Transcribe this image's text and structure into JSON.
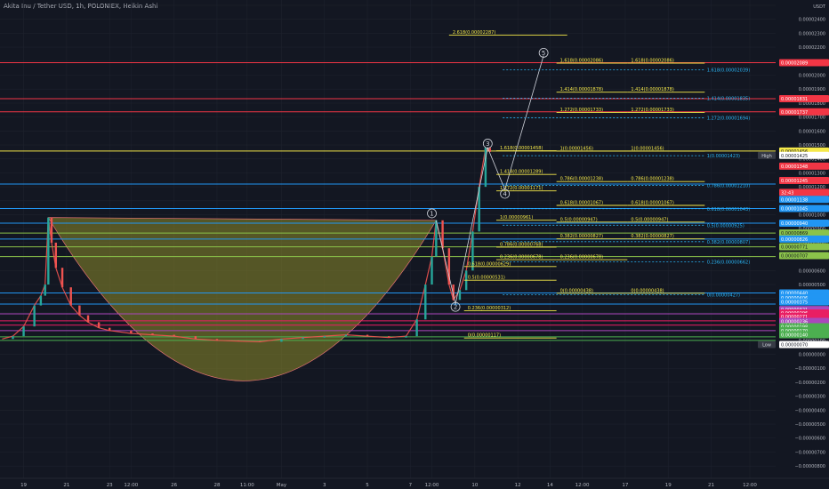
{
  "header": {
    "title": "Akita Inu / Tether USD, 1h, POLONIEX, Heikin Ashi"
  },
  "chart_data": {
    "type": "candlestick",
    "quote": "USDT",
    "ylim": [
      -8.5e-06,
      2.5e-05
    ],
    "y_ticks": [
      {
        "v": 2.5e-05,
        "label": "0.00002500"
      },
      {
        "v": 2.4e-05,
        "label": "0.00002400"
      },
      {
        "v": 2.3e-05,
        "label": "0.00002300"
      },
      {
        "v": 2.2e-05,
        "label": "0.00002200"
      },
      {
        "v": 2.1e-05,
        "label": "0.00002100"
      },
      {
        "v": 2e-05,
        "label": "0.00002000"
      },
      {
        "v": 1.9e-05,
        "label": "0.00001900"
      },
      {
        "v": 1.8e-05,
        "label": "0.00001800"
      },
      {
        "v": 1.7e-05,
        "label": "0.00001700"
      },
      {
        "v": 1.6e-05,
        "label": "0.00001600"
      },
      {
        "v": 1.5e-05,
        "label": "0.00001500"
      },
      {
        "v": 1.4e-05,
        "label": "0.00001400"
      },
      {
        "v": 1.3e-05,
        "label": "0.00001300"
      },
      {
        "v": 1.2e-05,
        "label": "0.00001200"
      },
      {
        "v": 1.1e-05,
        "label": "0.00001100"
      },
      {
        "v": 1e-05,
        "label": "0.00001000"
      },
      {
        "v": 9e-06,
        "label": "0.00000900"
      },
      {
        "v": 8e-06,
        "label": "0.00000800"
      },
      {
        "v": 7e-06,
        "label": "0.00000700"
      },
      {
        "v": 6e-06,
        "label": "0.00000600"
      },
      {
        "v": 5e-06,
        "label": "0.00000500"
      },
      {
        "v": 4e-06,
        "label": "0.00000400"
      },
      {
        "v": 3e-06,
        "label": "0.00000300"
      },
      {
        "v": 2e-06,
        "label": "0.00000200"
      },
      {
        "v": 1e-06,
        "label": "0.00000100"
      },
      {
        "v": 0.0,
        "label": "0.00000000"
      },
      {
        "v": -1e-06,
        "label": "−0.00000100"
      },
      {
        "v": -2e-06,
        "label": "−0.00000200"
      },
      {
        "v": -3e-06,
        "label": "−0.00000300"
      },
      {
        "v": -4e-06,
        "label": "−0.00000400"
      },
      {
        "v": -5e-06,
        "label": "−0.00000500"
      },
      {
        "v": -6e-06,
        "label": "−0.00000600"
      },
      {
        "v": -7e-06,
        "label": "−0.00000700"
      },
      {
        "v": -8e-06,
        "label": "−0.00000800"
      }
    ],
    "x_ticks": [
      {
        "t": 0,
        "label": "19"
      },
      {
        "t": 2,
        "label": "21"
      },
      {
        "t": 4,
        "label": "23"
      },
      {
        "t": 5,
        "label": "12:00"
      },
      {
        "t": 7,
        "label": "26"
      },
      {
        "t": 9,
        "label": "28"
      },
      {
        "t": 10.4,
        "label": "11:00"
      },
      {
        "t": 12,
        "label": "May"
      },
      {
        "t": 14,
        "label": "3"
      },
      {
        "t": 16,
        "label": "5"
      },
      {
        "t": 18,
        "label": "7"
      },
      {
        "t": 19,
        "label": "12:00"
      },
      {
        "t": 21,
        "label": "10"
      },
      {
        "t": 23,
        "label": "12"
      },
      {
        "t": 24.5,
        "label": "14"
      },
      {
        "t": 26,
        "label": "12:00"
      },
      {
        "t": 28,
        "label": "17"
      },
      {
        "t": 30,
        "label": "19"
      },
      {
        "t": 32,
        "label": "21"
      },
      {
        "t": 33.8,
        "label": "12:00"
      }
    ],
    "xlim": [
      -1.1,
      35
    ],
    "price_series": [
      [
        -1.0,
        1.1e-06
      ],
      [
        -0.5,
        1.3e-06
      ],
      [
        0.0,
        2e-06
      ],
      [
        0.5,
        3.5e-06
      ],
      [
        0.8,
        4.2e-06
      ],
      [
        1.0,
        5e-06
      ],
      [
        1.15,
        9.8e-06
      ],
      [
        1.3,
        8e-06
      ],
      [
        1.5,
        6.2e-06
      ],
      [
        1.8,
        4.8e-06
      ],
      [
        2.2,
        3.5e-06
      ],
      [
        2.6,
        2.8e-06
      ],
      [
        3.0,
        2.3e-06
      ],
      [
        3.5,
        1.9e-06
      ],
      [
        4.0,
        1.7e-06
      ],
      [
        5.0,
        1.5e-06
      ],
      [
        6.0,
        1.4e-06
      ],
      [
        7.0,
        1.3e-06
      ],
      [
        8.0,
        1.1e-06
      ],
      [
        9.0,
        1e-06
      ],
      [
        10.0,
        9.5e-07
      ],
      [
        11.0,
        9e-07
      ],
      [
        12.0,
        1.1e-06
      ],
      [
        13.0,
        1.2e-06
      ],
      [
        14.0,
        1.3e-06
      ],
      [
        15.0,
        1.4e-06
      ],
      [
        16.0,
        1.3e-06
      ],
      [
        17.0,
        1.2e-06
      ],
      [
        17.8,
        1.3e-06
      ],
      [
        18.3,
        2.5e-06
      ],
      [
        18.7,
        5e-06
      ],
      [
        19.0,
        7e-06
      ],
      [
        19.2,
        9.6e-06
      ],
      [
        19.5,
        7.6e-06
      ],
      [
        19.8,
        5e-06
      ],
      [
        20.0,
        3.9e-06
      ],
      [
        20.3,
        4.6e-06
      ],
      [
        20.6,
        6e-06
      ],
      [
        20.9,
        8.8e-06
      ],
      [
        21.2,
        1.2e-05
      ],
      [
        21.5,
        1.48e-05
      ],
      [
        21.7,
        1.45e-05
      ]
    ],
    "cup_arc": {
      "start": [
        1.15,
        9.8e-06
      ],
      "end": [
        19.2,
        9.6e-06
      ],
      "bottom": [
        10.2,
        -1.9e-06
      ]
    },
    "wave_labels": [
      {
        "label": "1",
        "t": 19.0,
        "v": 1.01e-05
      },
      {
        "label": "2",
        "t": 20.1,
        "v": 3.4e-06
      },
      {
        "label": "3",
        "t": 21.6,
        "v": 1.51e-05
      },
      {
        "label": "4",
        "t": 22.4,
        "v": 1.15e-05
      },
      {
        "label": "5",
        "t": 24.2,
        "v": 2.16e-05
      }
    ],
    "wave_path": [
      [
        19.2,
        9.6e-06
      ],
      [
        20.1,
        3.6e-06
      ],
      [
        21.6,
        1.48e-05
      ],
      [
        22.4,
        1.18e-05
      ],
      [
        24.2,
        2.14e-05
      ]
    ],
    "horizontal_levels": [
      {
        "v": 2.089e-05,
        "color": "#f23645",
        "label": "0.00002089"
      },
      {
        "v": 1.831e-05,
        "color": "#f23645",
        "label": "0.00001831"
      },
      {
        "v": 1.737e-05,
        "color": "#f23645",
        "label": "0.00001737"
      },
      {
        "v": 1.456e-05,
        "color": "#f5e94a",
        "label": "0.00001456"
      },
      {
        "v": 1.22e-05,
        "color": "#2196f3",
        "label": ""
      },
      {
        "v": 1.045e-05,
        "color": "#2196f3",
        "label": ""
      },
      {
        "v": 9.4e-06,
        "color": "#2196f3",
        "label": ""
      },
      {
        "v": 8.69e-06,
        "color": "#8bc34a",
        "label": ""
      },
      {
        "v": 8.26e-06,
        "color": "#2196f3",
        "label": ""
      },
      {
        "v": 7.7e-06,
        "color": "#8bc34a",
        "label": ""
      },
      {
        "v": 7e-06,
        "color": "#8bc34a",
        "label": ""
      },
      {
        "v": 4.4e-06,
        "color": "#2196f3",
        "label": ""
      },
      {
        "v": 3.6e-06,
        "color": "#2196f3",
        "label": ""
      },
      {
        "v": 2.9e-06,
        "color": "#ab47bc",
        "label": ""
      },
      {
        "v": 2.4e-06,
        "color": "#e91e63",
        "label": ""
      },
      {
        "v": 2.1e-06,
        "color": "#e91e63",
        "label": ""
      },
      {
        "v": 1.7e-06,
        "color": "#ab47bc",
        "label": ""
      },
      {
        "v": 1.25e-06,
        "color": "#4caf50",
        "label": ""
      },
      {
        "v": 1e-06,
        "color": "#4caf50",
        "label": ""
      }
    ],
    "fib_yellow": [
      {
        "label": "2.618(0.00002287)",
        "v": 2.287e-05,
        "x1": 19.8,
        "x2": 25.3
      },
      {
        "label": "1.618(0.00002086)",
        "v": 2.086e-05,
        "x1": 24.8,
        "x2": 28.1
      },
      {
        "label": "1.618(0.00002086)",
        "v": 2.086e-05,
        "x1": 28.1,
        "x2": 31.7
      },
      {
        "label": "1.414(0.00001878)",
        "v": 1.878e-05,
        "x1": 24.8,
        "x2": 28.1
      },
      {
        "label": "1.414(0.00001878)",
        "v": 1.878e-05,
        "x1": 28.1,
        "x2": 31.7
      },
      {
        "label": "1.272(0.00001733)",
        "v": 1.733e-05,
        "x1": 24.8,
        "x2": 28.1
      },
      {
        "label": "1.272(0.00001733)",
        "v": 1.733e-05,
        "x1": 28.1,
        "x2": 31.7
      },
      {
        "label": "1.618(0.00001458)",
        "v": 1.458e-05,
        "x1": 22.0,
        "x2": 24.8
      },
      {
        "label": "1(0.00001456)",
        "v": 1.456e-05,
        "x1": 24.8,
        "x2": 28.1
      },
      {
        "label": "1(0.00001456)",
        "v": 1.456e-05,
        "x1": 28.1,
        "x2": 31.7
      },
      {
        "label": "1.414(0.00001289)",
        "v": 1.289e-05,
        "x1": 22.0,
        "x2": 24.8
      },
      {
        "label": "0.786(0.00001238)",
        "v": 1.238e-05,
        "x1": 24.8,
        "x2": 28.1
      },
      {
        "label": "0.786(0.00001238)",
        "v": 1.238e-05,
        "x1": 28.1,
        "x2": 31.7
      },
      {
        "label": "1.272(0.00001171)",
        "v": 1.171e-05,
        "x1": 22.0,
        "x2": 24.8
      },
      {
        "label": "0.618(0.00001067)",
        "v": 1.067e-05,
        "x1": 24.8,
        "x2": 28.1
      },
      {
        "label": "0.618(0.00001067)",
        "v": 1.067e-05,
        "x1": 28.1,
        "x2": 31.7
      },
      {
        "label": "1(0.00000961)",
        "v": 9.61e-06,
        "x1": 22.0,
        "x2": 24.8
      },
      {
        "label": "0.5(0.00000947)",
        "v": 9.47e-06,
        "x1": 24.8,
        "x2": 28.1
      },
      {
        "label": "0.5(0.00000947)",
        "v": 9.47e-06,
        "x1": 28.1,
        "x2": 31.7
      },
      {
        "label": "0.382(0.00000827)",
        "v": 8.27e-06,
        "x1": 24.8,
        "x2": 28.1
      },
      {
        "label": "0.382(0.00000827)",
        "v": 8.27e-06,
        "x1": 28.1,
        "x2": 31.7
      },
      {
        "label": "0.786(0.00000768)",
        "v": 7.68e-06,
        "x1": 22.0,
        "x2": 24.8
      },
      {
        "label": "0.236(0.00000678)",
        "v": 6.78e-06,
        "x1": 22.0,
        "x2": 24.8
      },
      {
        "label": "0.236(0.00000678)",
        "v": 6.78e-06,
        "x1": 24.8,
        "x2": 28.1
      },
      {
        "label": "0.618(0.00000629)",
        "v": 6.29e-06,
        "x1": 20.5,
        "x2": 24.8
      },
      {
        "label": "0.5(0.00000531)",
        "v": 5.31e-06,
        "x1": 20.5,
        "x2": 24.8
      },
      {
        "label": "0(0.00000438)",
        "v": 4.38e-06,
        "x1": 24.8,
        "x2": 28.1
      },
      {
        "label": "0(0.00000438)",
        "v": 4.38e-06,
        "x1": 28.1,
        "x2": 31.7
      },
      {
        "label": "0.236(0.00000312)",
        "v": 3.12e-06,
        "x1": 20.5,
        "x2": 24.8
      },
      {
        "label": "0(0.00000117)",
        "v": 1.17e-06,
        "x1": 20.5,
        "x2": 24.8
      }
    ],
    "fib_blue": [
      {
        "label": "1.618(0.00002039)",
        "v": 2.039e-05
      },
      {
        "label": "1.414(0.00001835)",
        "v": 1.835e-05
      },
      {
        "label": "1.272(0.00001694)",
        "v": 1.694e-05
      },
      {
        "label": "1(0.00001423)",
        "v": 1.423e-05
      },
      {
        "label": "0.786(0.00001210)",
        "v": 1.21e-05
      },
      {
        "label": "0.618(0.00001043)",
        "v": 1.043e-05
      },
      {
        "label": "0.5(0.00000925)",
        "v": 9.25e-06
      },
      {
        "label": "0.382(0.00000807)",
        "v": 8.07e-06
      },
      {
        "label": "0.236(0.00000662)",
        "v": 6.62e-06
      },
      {
        "label": "0(0.00000427)",
        "v": 4.27e-06
      }
    ],
    "axis_tags": [
      {
        "text": "0.00002089",
        "v": 2.089e-05,
        "bg": "#f23645",
        "fg": "#ffffff"
      },
      {
        "text": "0.00001831",
        "v": 1.831e-05,
        "bg": "#f23645",
        "fg": "#ffffff"
      },
      {
        "text": "0.00001737",
        "v": 1.737e-05,
        "bg": "#f23645",
        "fg": "#ffffff"
      },
      {
        "text": "0.00001456",
        "v": 1.456e-05,
        "bg": "#f5e94a",
        "fg": "#131722"
      },
      {
        "text": "0.00001425",
        "v": 1.425e-05,
        "bg": "#ffffff",
        "fg": "#131722",
        "side": "High"
      },
      {
        "text": "0.00001348",
        "v": 1.348e-05,
        "bg": "#f23645",
        "fg": "#ffffff"
      },
      {
        "text": "0.00001245",
        "v": 1.245e-05,
        "bg": "#f23645",
        "fg": "#ffffff"
      },
      {
        "text": "32:43",
        "v": 1.16e-05,
        "bg": "#f23645",
        "fg": "#ffffff"
      },
      {
        "text": "0.00001138",
        "v": 1.11e-05,
        "bg": "#2196f3",
        "fg": "#ffffff"
      },
      {
        "text": "0.00001045",
        "v": 1.045e-05,
        "bg": "#2196f3",
        "fg": "#ffffff"
      },
      {
        "text": "0.00000940",
        "v": 9.4e-06,
        "bg": "#2196f3",
        "fg": "#ffffff"
      },
      {
        "text": "0.00000869",
        "v": 8.69e-06,
        "bg": "#8bc34a",
        "fg": "#131722"
      },
      {
        "text": "0.00000826",
        "v": 8.26e-06,
        "bg": "#2196f3",
        "fg": "#ffffff"
      },
      {
        "text": "0.00000771",
        "v": 7.71e-06,
        "bg": "#8bc34a",
        "fg": "#131722"
      },
      {
        "text": "0.00000707",
        "v": 7.07e-06,
        "bg": "#8bc34a",
        "fg": "#131722"
      },
      {
        "text": "0.00000440",
        "v": 4.4e-06,
        "bg": "#2196f3",
        "fg": "#ffffff"
      },
      {
        "text": "0.00000406",
        "v": 4.06e-06,
        "bg": "#2196f3",
        "fg": "#ffffff"
      },
      {
        "text": "0.00000375",
        "v": 3.75e-06,
        "bg": "#2196f3",
        "fg": "#ffffff"
      },
      {
        "text": "0.00000321",
        "v": 3.21e-06,
        "bg": "#ab47bc",
        "fg": "#ffffff"
      },
      {
        "text": "0.00000296",
        "v": 2.96e-06,
        "bg": "#e91e63",
        "fg": "#ffffff"
      },
      {
        "text": "0.00000271",
        "v": 2.71e-06,
        "bg": "#e91e63",
        "fg": "#ffffff"
      },
      {
        "text": "0.00000236",
        "v": 2.36e-06,
        "bg": "#ab47bc",
        "fg": "#ffffff"
      },
      {
        "text": "0.00000198",
        "v": 1.98e-06,
        "bg": "#4caf50",
        "fg": "#ffffff"
      },
      {
        "text": "0.00000170",
        "v": 1.7e-06,
        "bg": "#4caf50",
        "fg": "#ffffff"
      },
      {
        "text": "0.00000140",
        "v": 1.4e-06,
        "bg": "#4caf50",
        "fg": "#ffffff"
      },
      {
        "text": "0.00000070",
        "v": 7e-07,
        "bg": "#ffffff",
        "fg": "#131722",
        "side": "Low"
      }
    ],
    "colors": {
      "background": "#131722",
      "grid": "#1e222d",
      "cup": "#8d8a2a",
      "wave": "#d1d4dc",
      "axis_text": "#b2b5be",
      "up": "#26a69a",
      "down": "#ef5350"
    }
  }
}
